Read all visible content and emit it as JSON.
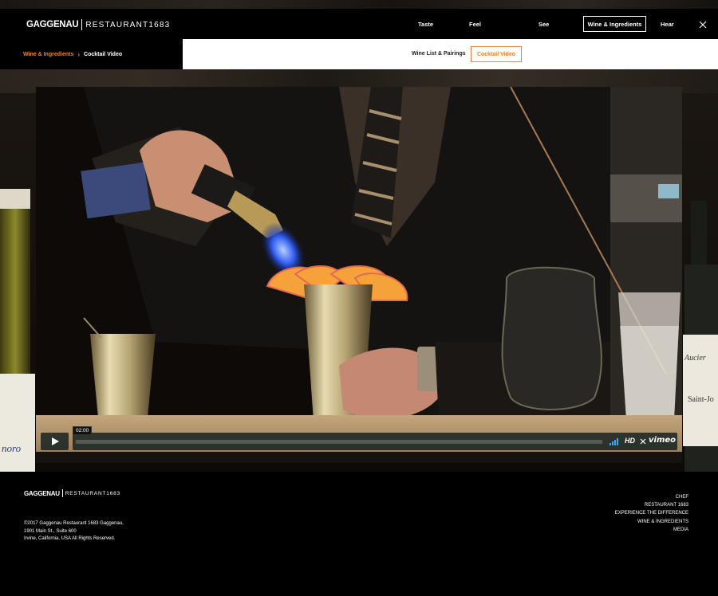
{
  "header": {
    "brand_main": "GAGGENAU",
    "brand_sub": "RESTAURANT1683",
    "nav": [
      {
        "label": "Taste"
      },
      {
        "label": "Feel"
      },
      {
        "label": "See"
      },
      {
        "label": "Wine & Ingredients",
        "active": true
      },
      {
        "label": "Hear"
      }
    ],
    "close_icon": "close-icon"
  },
  "subnav": {
    "breadcrumb": {
      "parent": "Wine & Ingredients",
      "separator": "›",
      "current": "Cocktail Video"
    },
    "links": [
      {
        "label": "Wine List & Pairings"
      },
      {
        "label": "Cocktail Video",
        "active": true
      }
    ]
  },
  "video": {
    "time": "02:00",
    "hd_label": "HD",
    "brand": "vimeo",
    "progress": 0,
    "icons": [
      "play-icon",
      "volume-icon",
      "fullscreen-icon"
    ]
  },
  "footer": {
    "brand_main": "GAGGENAU",
    "brand_sub": "RESTAURANT1683",
    "address": [
      "©2017 Gaggenau Restaurant 1683 Gaggenau,",
      "1901 Main St., Suite 600",
      "Irvine, California, USA All Rights Reserved."
    ],
    "links": [
      "CHEF",
      "RESTAURANT 1683",
      "EXPERIENCE THE DIFFERENCE",
      "WINE & INGREDIENTS",
      "MEDIA"
    ]
  },
  "colors": {
    "accent": "#f0822b",
    "background": "#000000",
    "subnav_bg": "#ffffff"
  }
}
